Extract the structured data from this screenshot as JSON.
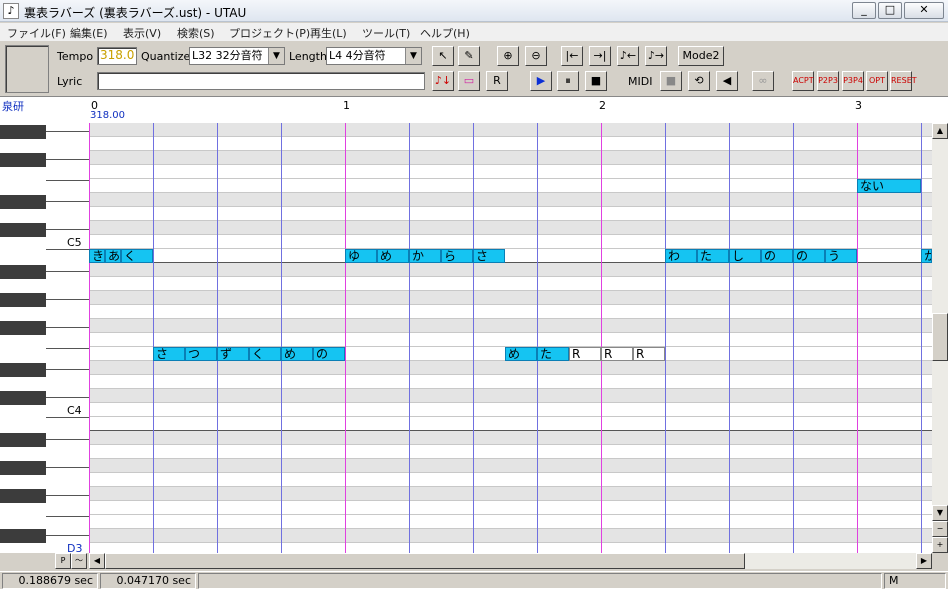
{
  "window": {
    "title": "裏表ラバーズ (裏表ラバーズ.ust) - UTAU",
    "app_icon": "♪",
    "minimize": "_",
    "maximize": "□",
    "close": "✕"
  },
  "menu": [
    "ファイル(F)",
    "編集(E)",
    "表示(V)",
    "検索(S)",
    "プロジェクト(P)",
    "再生(L)",
    "ツール(T)",
    "ヘルプ(H)"
  ],
  "toolbar": {
    "tempo_label": "Tempo",
    "tempo_value": "318.0",
    "quantize_label": "Quantize",
    "quantize_value": "L32 32分音符",
    "length_label": "Length",
    "length_value": "L4 4分音符",
    "lyric_label": "Lyric",
    "lyric_value": "",
    "mode2_label": "Mode2",
    "midi_label": "MIDI",
    "tools": {
      "select": "↖",
      "pencil": "✎",
      "zoom_in": "⊕",
      "zoom_out": "⊖",
      "go_start": "|←",
      "go_end": "→|",
      "note_left": "♪←",
      "note_right": "♪→",
      "insert_note": "♪↓",
      "insert_blank": "▭",
      "insert_rest": "R",
      "play": "▶",
      "pause": "⏸",
      "stop": "■",
      "midi_stop": "■",
      "midi_loop": "⟲",
      "speaker": "◀",
      "link": "∞",
      "acpt": "ACPT",
      "p2p3": "P2P3",
      "p3p4": "P3P4",
      "opt": "OPT",
      "reset": "RESET"
    }
  },
  "ruler": {
    "singer": "泉研",
    "tempo_mark": "318.00",
    "measures": [
      "0",
      "1",
      "2",
      "3"
    ]
  },
  "piano": {
    "octave_labels": [
      "C5",
      "C4",
      "D3"
    ]
  },
  "notes": [
    {
      "lyric": "ない",
      "kind": "blue"
    },
    {
      "lyric": "き",
      "kind": "blue"
    },
    {
      "lyric": "あ",
      "kind": "blue"
    },
    {
      "lyric": "く",
      "kind": "blue"
    },
    {
      "lyric": "ゆ",
      "kind": "blue"
    },
    {
      "lyric": "め",
      "kind": "blue"
    },
    {
      "lyric": "か",
      "kind": "blue"
    },
    {
      "lyric": "ら",
      "kind": "blue"
    },
    {
      "lyric": "さ",
      "kind": "blue"
    },
    {
      "lyric": "わ",
      "kind": "blue"
    },
    {
      "lyric": "た",
      "kind": "blue"
    },
    {
      "lyric": "し",
      "kind": "blue"
    },
    {
      "lyric": "の",
      "kind": "blue"
    },
    {
      "lyric": "の",
      "kind": "blue"
    },
    {
      "lyric": "う",
      "kind": "blue"
    },
    {
      "lyric": "か",
      "kind": "blue"
    },
    {
      "lyric": "さ",
      "kind": "blue"
    },
    {
      "lyric": "つ",
      "kind": "blue"
    },
    {
      "lyric": "ず",
      "kind": "blue"
    },
    {
      "lyric": "く",
      "kind": "blue"
    },
    {
      "lyric": "め",
      "kind": "blue"
    },
    {
      "lyric": "の",
      "kind": "blue"
    },
    {
      "lyric": "め",
      "kind": "blue"
    },
    {
      "lyric": "た",
      "kind": "blue"
    },
    {
      "lyric": "R",
      "kind": "rest"
    },
    {
      "lyric": "R",
      "kind": "rest"
    },
    {
      "lyric": "R",
      "kind": "rest"
    }
  ],
  "scroll": {
    "up": "▲",
    "down": "▼",
    "minus": "−",
    "plus": "+",
    "left": "◀",
    "right": "▶",
    "p_button": "P",
    "tilde_button": "〜"
  },
  "status": {
    "time1": "0.188679 sec",
    "time2": "0.047170 sec",
    "mode": "M"
  }
}
